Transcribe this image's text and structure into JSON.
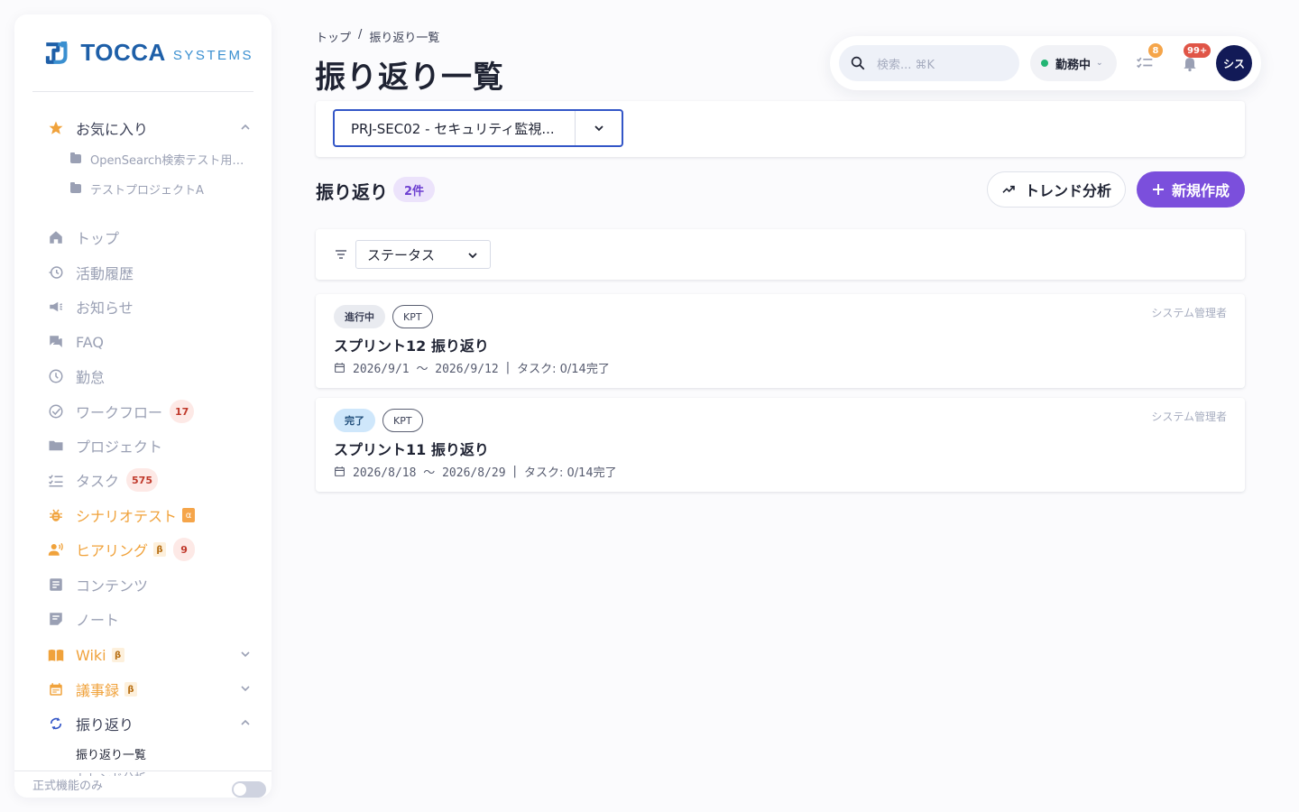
{
  "brand": {
    "name": "TOCCA",
    "sub": "SYSTEMS"
  },
  "sidebar": {
    "favorites": {
      "label": "お気に入り",
      "items": [
        {
          "label": "OpenSearch検索テスト用プ..."
        },
        {
          "label": "テストプロジェクトA"
        }
      ]
    },
    "items": [
      {
        "label": "トップ",
        "icon": "home-icon"
      },
      {
        "label": "活動履歴",
        "icon": "history-icon"
      },
      {
        "label": "お知らせ",
        "icon": "megaphone-icon"
      },
      {
        "label": "FAQ",
        "icon": "forum-icon"
      },
      {
        "label": "勤怠",
        "icon": "clock-icon"
      },
      {
        "label": "ワークフロー",
        "icon": "check-circle-icon",
        "badge": "17"
      },
      {
        "label": "プロジェクト",
        "icon": "folder-icon"
      },
      {
        "label": "タスク",
        "icon": "checklist-icon",
        "badge": "575"
      },
      {
        "label": "シナリオテスト",
        "icon": "bug-icon",
        "tag": "α"
      },
      {
        "label": "ヒアリング",
        "icon": "voice-icon",
        "tag": "β",
        "badge": "9"
      },
      {
        "label": "コンテンツ",
        "icon": "article-icon"
      },
      {
        "label": "ノート",
        "icon": "note-icon"
      },
      {
        "label": "Wiki",
        "icon": "book-icon",
        "tag": "β"
      },
      {
        "label": "議事録",
        "icon": "calendar-icon",
        "tag": "β"
      },
      {
        "label": "振り返り",
        "icon": "sync-icon"
      }
    ],
    "sub_active": "振り返り一覧",
    "sub_next": "トレンド分析",
    "footer_label": "正式機能のみ"
  },
  "header": {
    "breadcrumb": {
      "home": "トップ",
      "separator": "/",
      "current": "振り返り一覧"
    },
    "title": "振り返り一覧"
  },
  "topbar": {
    "search_placeholder": "検索... ⌘K",
    "status": "勤務中",
    "task_badge": "8",
    "notification_badge": "99+",
    "avatar": "シス"
  },
  "project_select": {
    "value": "PRJ-SEC02 - セキュリティ監視..."
  },
  "section": {
    "title": "振り返り",
    "count": "2件",
    "trend_button": "トレンド分析",
    "new_button": "新規作成"
  },
  "filter": {
    "status_label": "ステータス"
  },
  "retros": [
    {
      "status": "進行中",
      "type": "KPT",
      "title": "スプリント12 振り返り",
      "date_range": "2026/9/1 ～ 2026/9/12",
      "tasks": "タスク: 0/14完了",
      "owner": "システム管理者"
    },
    {
      "status": "完了",
      "type": "KPT",
      "title": "スプリント11 振り返り",
      "date_range": "2026/8/18 ～ 2026/8/29",
      "tasks": "タスク: 0/14完了",
      "owner": "システム管理者"
    }
  ],
  "colors": {
    "accent": "#7b4fdc",
    "brand": "#1e5fa8",
    "favorite": "#f0a23b",
    "badge_bg": "#fde9e6",
    "status_online": "#22b573",
    "avatar_bg": "#121a57"
  }
}
